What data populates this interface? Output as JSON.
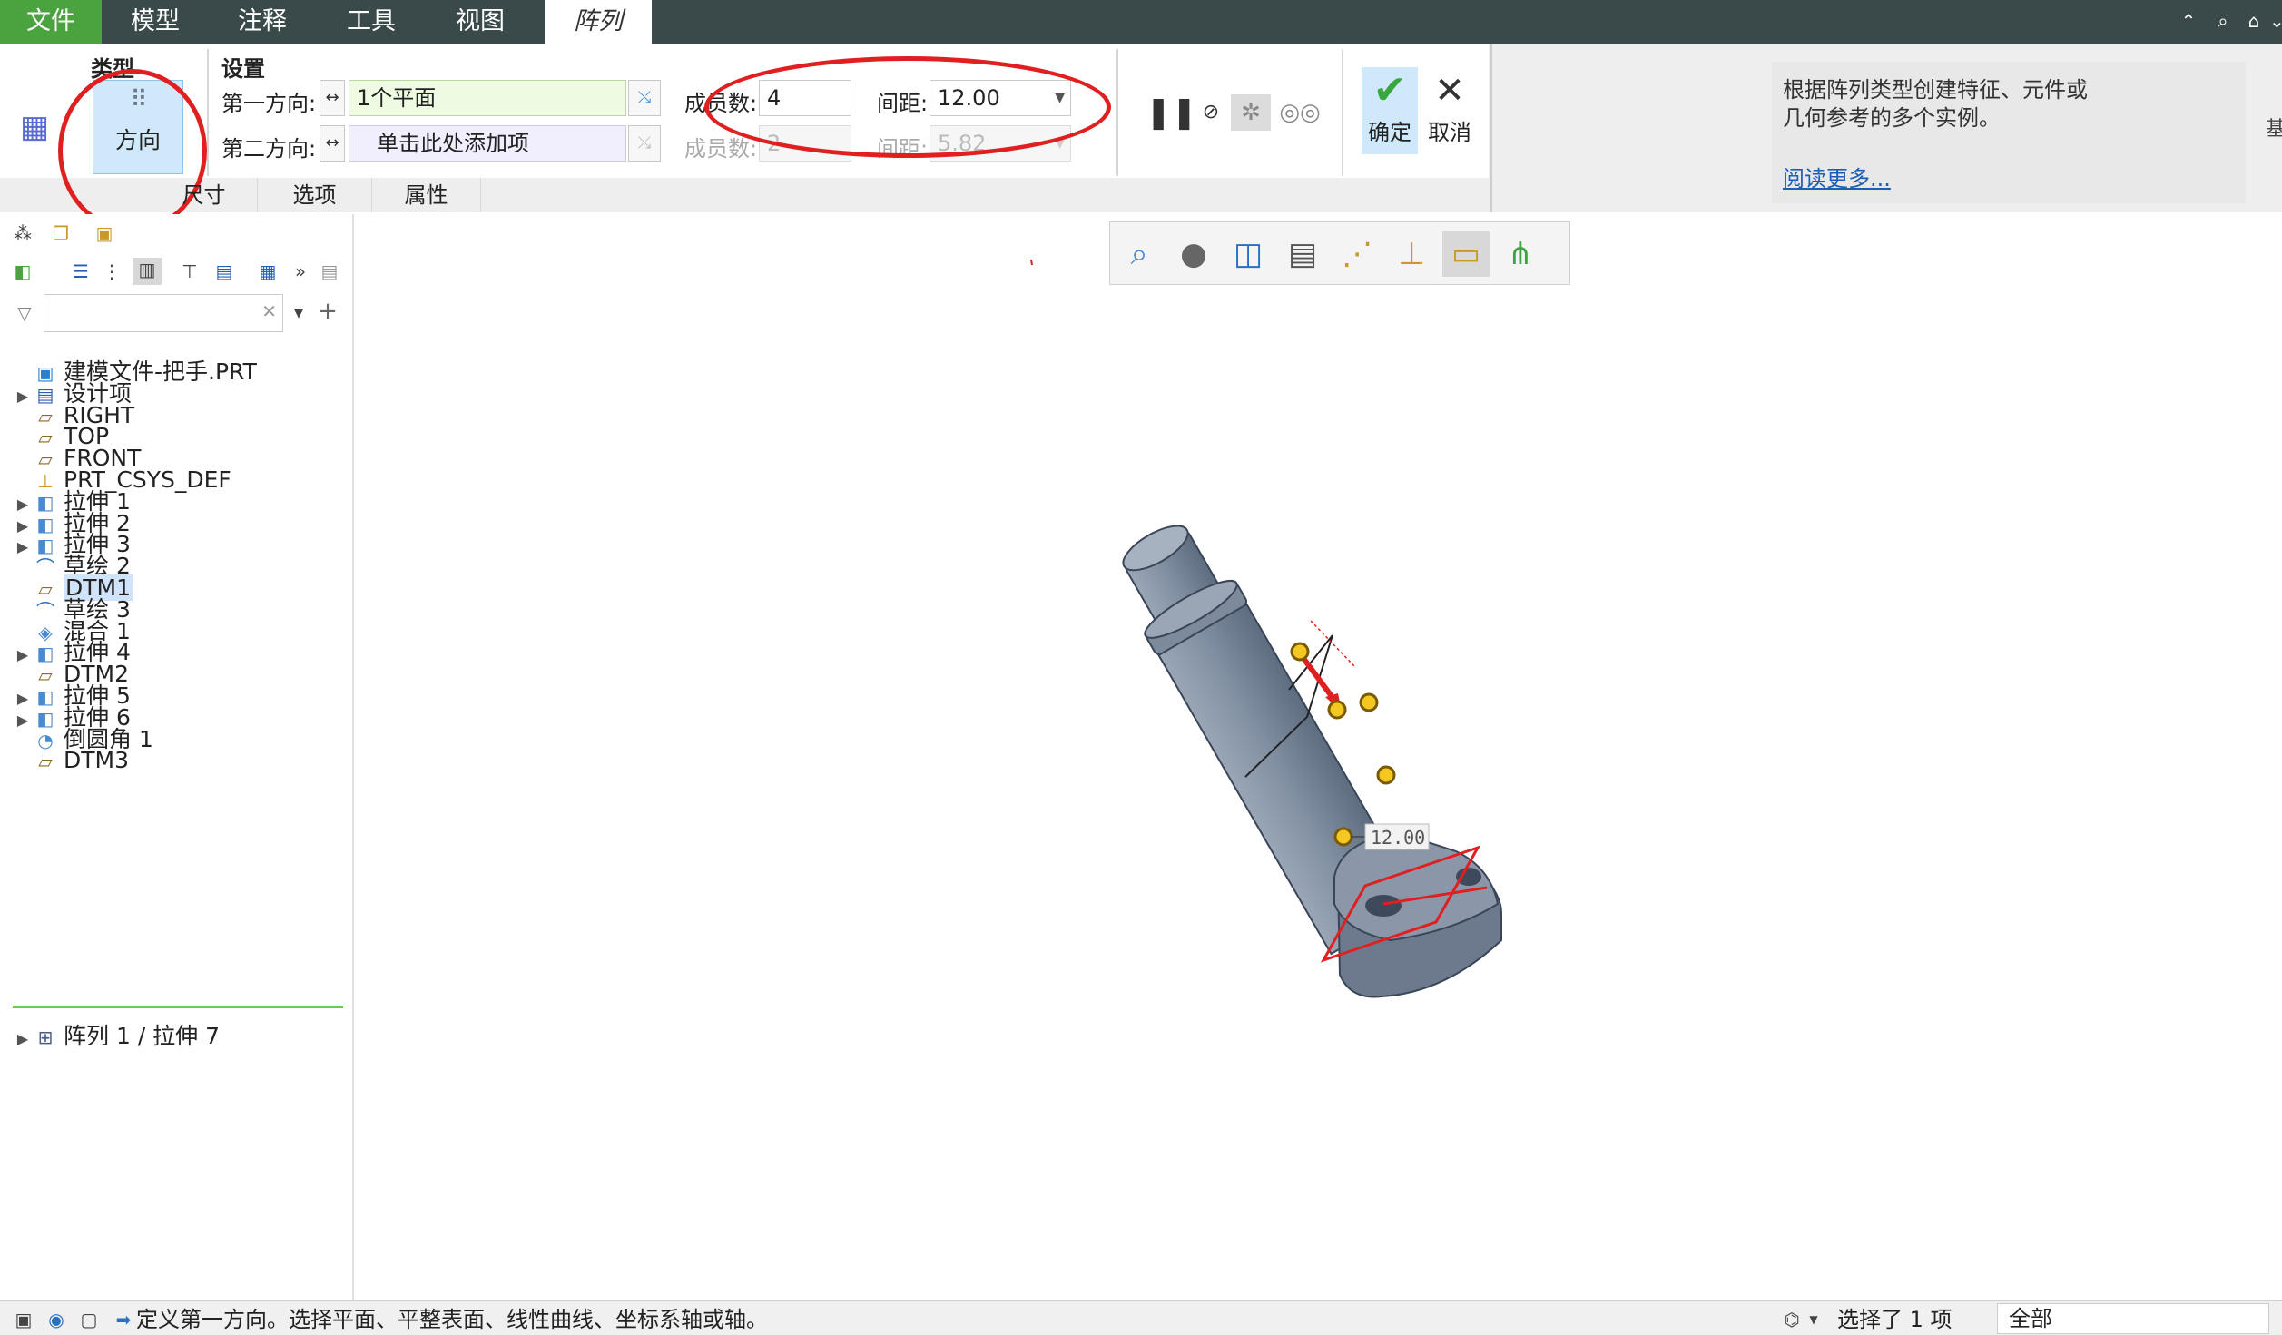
{
  "menu": {
    "tabs": [
      {
        "label": "文件"
      },
      {
        "label": "模型"
      },
      {
        "label": "注释"
      },
      {
        "label": "工具"
      },
      {
        "label": "视图"
      },
      {
        "label": "阵列"
      }
    ],
    "active_tab": "阵列",
    "file_tab_color": "#4aa33f"
  },
  "ribbon": {
    "type_group_label": "类型",
    "type_button_label": "方向",
    "settings_group_label": "设置",
    "dir1_label": "第一方向:",
    "dir1_value": "1个平面",
    "dir2_label": "第二方向:",
    "dir2_placeholder": "单击此处添加项",
    "members1_label": "成员数:",
    "members1_value": "4",
    "spacing1_label": "间距:",
    "spacing1_value": "12.00",
    "members2_label": "成员数:",
    "members2_value": "2",
    "spacing2_label": "间距:",
    "spacing2_value": "5.82",
    "subtabs": [
      {
        "label": "尺寸"
      },
      {
        "label": "选项"
      },
      {
        "label": "属性"
      }
    ],
    "ok_label": "确定",
    "cancel_label": "取消",
    "help_text_line1": "根据阵列类型创建特征、元件或",
    "help_text_line2": "几何参考的多个实例。",
    "help_link": "阅读更多...",
    "right_edge_label": "基"
  },
  "tree": {
    "search_value": "",
    "items": [
      {
        "label": "建模文件-把手.PRT",
        "icon": "part-icon",
        "expandable": false
      },
      {
        "label": "设计项",
        "icon": "design-items-icon",
        "expandable": true
      },
      {
        "label": "RIGHT",
        "icon": "datum-plane-icon",
        "expandable": false
      },
      {
        "label": "TOP",
        "icon": "datum-plane-icon",
        "expandable": false
      },
      {
        "label": "FRONT",
        "icon": "datum-plane-icon",
        "expandable": false
      },
      {
        "label": "PRT_CSYS_DEF",
        "icon": "csys-icon",
        "expandable": false
      },
      {
        "label": "拉伸 1",
        "icon": "extrude-icon",
        "expandable": true
      },
      {
        "label": "拉伸 2",
        "icon": "extrude-icon",
        "expandable": true
      },
      {
        "label": "拉伸 3",
        "icon": "extrude-icon",
        "expandable": true
      },
      {
        "label": "草绘 2",
        "icon": "sketch-icon",
        "expandable": false
      },
      {
        "label": "DTM1",
        "icon": "datum-plane-icon",
        "expandable": false,
        "selected": true
      },
      {
        "label": "草绘 3",
        "icon": "sketch-icon",
        "expandable": false
      },
      {
        "label": "混合 1",
        "icon": "blend-icon",
        "expandable": false
      },
      {
        "label": "拉伸 4",
        "icon": "extrude-icon",
        "expandable": true
      },
      {
        "label": "DTM2",
        "icon": "datum-plane-icon",
        "expandable": false
      },
      {
        "label": "拉伸 5",
        "icon": "extrude-icon",
        "expandable": true
      },
      {
        "label": "拉伸 6",
        "icon": "extrude-icon",
        "expandable": true
      },
      {
        "label": "倒圆角 1",
        "icon": "round-icon",
        "expandable": false
      },
      {
        "label": "DTM3",
        "icon": "datum-plane-icon",
        "expandable": false
      }
    ],
    "pattern_item": {
      "label": "阵列 1 / 拉伸 7",
      "icon": "pattern-icon",
      "expandable": true
    }
  },
  "viewport": {
    "dimension_label": "12.00",
    "highlight_color": "#e02020",
    "model_color": "#7e8b9c"
  },
  "status": {
    "message": "定义第一方向。选择平面、平整表面、线性曲线、坐标系轴或轴。",
    "selection_count": "选择了 1 项",
    "filter_value": "全部"
  }
}
